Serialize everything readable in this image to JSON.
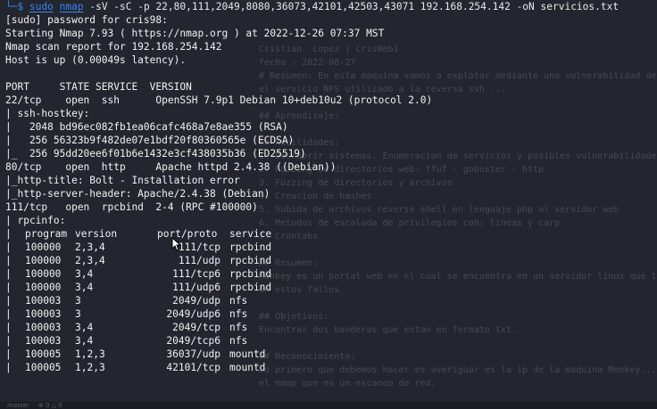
{
  "prompt": {
    "symbol": "└─$",
    "sudo": "sudo",
    "binary": "nmap",
    "args": " -sV -sC -p 22,80,111,2049,8080,36073,42101,42503,43071 192.168.254.142 -oN servicios.txt"
  },
  "output_lines": [
    "[sudo] password for cris98:",
    "Starting Nmap 7.93 ( https://nmap.org ) at 2022-12-26 07:37 MST",
    "Nmap scan report for 192.168.254.142",
    "Host is up (0.00049s latency).",
    "",
    "PORT     STATE SERVICE  VERSION",
    "22/tcp    open  ssh      OpenSSH 7.9p1 Debian 10+deb10u2 (protocol 2.0)",
    "| ssh-hostkey:",
    "|   2048 bd96ec082fb1ea06cafc468a7e8ae355 (RSA)",
    "|   256 56323b9f482de07e1bdf20f80360565e (ECDSA)",
    "|_  256 95dd20ee6f01b6e1432e3cf438035b36 (ED25519)",
    "80/tcp    open  http     Apache httpd 2.4.38 ((Debian))",
    "|_http-title: Bolt - Installation error",
    "|_http-server-header: Apache/2.4.38 (Debian)",
    "111/tcp   open  rpcbind  2-4 (RPC #100000)",
    "| rpcinfo:"
  ],
  "rpcinfo": {
    "header": [
      "program",
      "version",
      "port/proto",
      "service"
    ],
    "rows": [
      [
        "100000",
        "2,3,4",
        "111/tcp",
        "rpcbind"
      ],
      [
        "100000",
        "2,3,4",
        "111/udp",
        "rpcbind"
      ],
      [
        "100000",
        "3,4",
        "111/tcp6",
        "rpcbind"
      ],
      [
        "100000",
        "3,4",
        "111/udp6",
        "rpcbind"
      ],
      [
        "100003",
        "3",
        "2049/udp",
        "nfs"
      ],
      [
        "100003",
        "3",
        "2049/udp6",
        "nfs"
      ],
      [
        "100003",
        "3,4",
        "2049/tcp",
        "nfs"
      ],
      [
        "100003",
        "3,4",
        "2049/tcp6",
        "nfs"
      ],
      [
        "100005",
        "1,2,3",
        "36037/udp",
        "mountd"
      ],
      [
        "100005",
        "1,2,3",
        "42101/tcp",
        "mountd"
      ]
    ]
  },
  "background_editor": [
    "Cristian  Lopez | CrisWeb1 ",
    "fecha : 2022-08-27",
    "# Resumen: En esta maquina vamos a explotar mediante una vulnerabilidad de archivos montados",
    "el servicio NFS utilizado a la reversa ssh ...",
    "",
    "## Aprendizaje:",
    "",
    "## Habilidades:",
    "1. Descubrir sistemas. Enumeracion de servicios y posibles vulnerabilidades",
    "2. Fuzzing de directorios web: ffuf - gobuster - http",
    "3. Fuzzing de directorios y archivos",
    "4. Creacion de hashes",
    "5. Subida de archivos reverse shell en lenguaje php al servidor web",
    "6. Metodos de escalada de privilegios con: lineas y carp",
    "7. Crontabs",
    "",
    "## Resumen:",
    "Monkey es un portal web en el cual se encuentra en un servidor linux que tiene muchas",
    "en estos fallos",
    "",
    "## Objetivos:",
    "Encontrar dos banderas que estan en formato txt.",
    "",
    "## Reconocimiento:",
    "Lo primero que debemos hacer es averiguar es la ip de la maquina Monkey...",
    "el nmap que es un escaneo de red."
  ],
  "status_bar": {
    "branch": "master",
    "errors": "⊗ 0 △ 0",
    "item": "▢ 0 ⚠ 0"
  }
}
